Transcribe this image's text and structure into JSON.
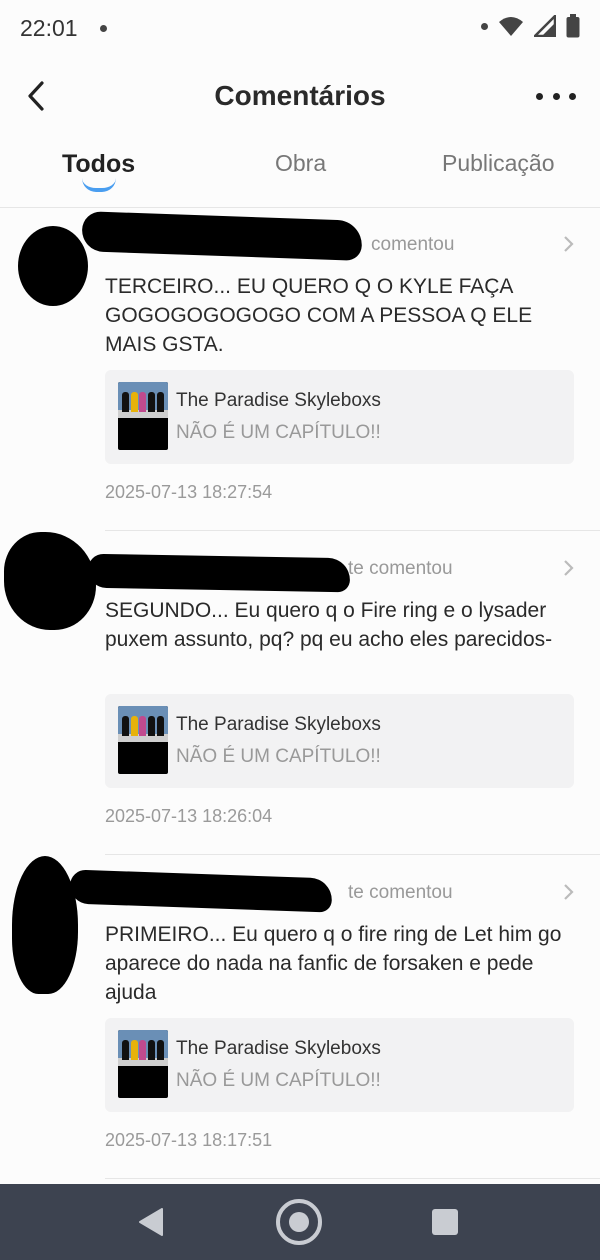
{
  "status_bar": {
    "time": "22:01"
  },
  "header": {
    "title": "Comentários"
  },
  "tabs": [
    {
      "label": "Todos",
      "active": true
    },
    {
      "label": "Obra",
      "active": false
    },
    {
      "label": "Publicação",
      "active": false
    }
  ],
  "comments": [
    {
      "action": "comentou",
      "text": "TERCEIRO... EU QUERO Q O KYLE FAÇA GOGOGOGOGOGO COM A PESSOA Q ELE MAIS GSTA.",
      "work_title": "The Paradise Skyleboxs",
      "work_subtitle": "NÃO É UM CAPÍTULO!!",
      "timestamp": "2025-07-13 18:27:54"
    },
    {
      "action": "te comentou",
      "text": "SEGUNDO... Eu quero q o Fire ring e o lysader puxem assunto, pq? pq eu acho eles parecidos-",
      "work_title": "The Paradise Skyleboxs",
      "work_subtitle": "NÃO É UM CAPÍTULO!!",
      "timestamp": "2025-07-13 18:26:04"
    },
    {
      "action": "te comentou",
      "text": "PRIMEIRO... Eu quero q o fire ring de Let him go aparece do nada na fanfic de forsaken e pede ajuda",
      "work_title": "The Paradise Skyleboxs",
      "work_subtitle": "NÃO É UM CAPÍTULO!!",
      "timestamp": "2025-07-13 18:17:51"
    }
  ],
  "colors": {
    "accent": "#4a9ef0",
    "nav_bar": "#3d4350",
    "card_bg": "#f2f2f3"
  },
  "icons": [
    "wifi-icon",
    "signal-icon",
    "battery-icon",
    "back-arrow-icon",
    "more-options-icon",
    "chevron-right-icon",
    "nav-back-icon",
    "nav-home-icon",
    "nav-recent-apps-icon"
  ]
}
